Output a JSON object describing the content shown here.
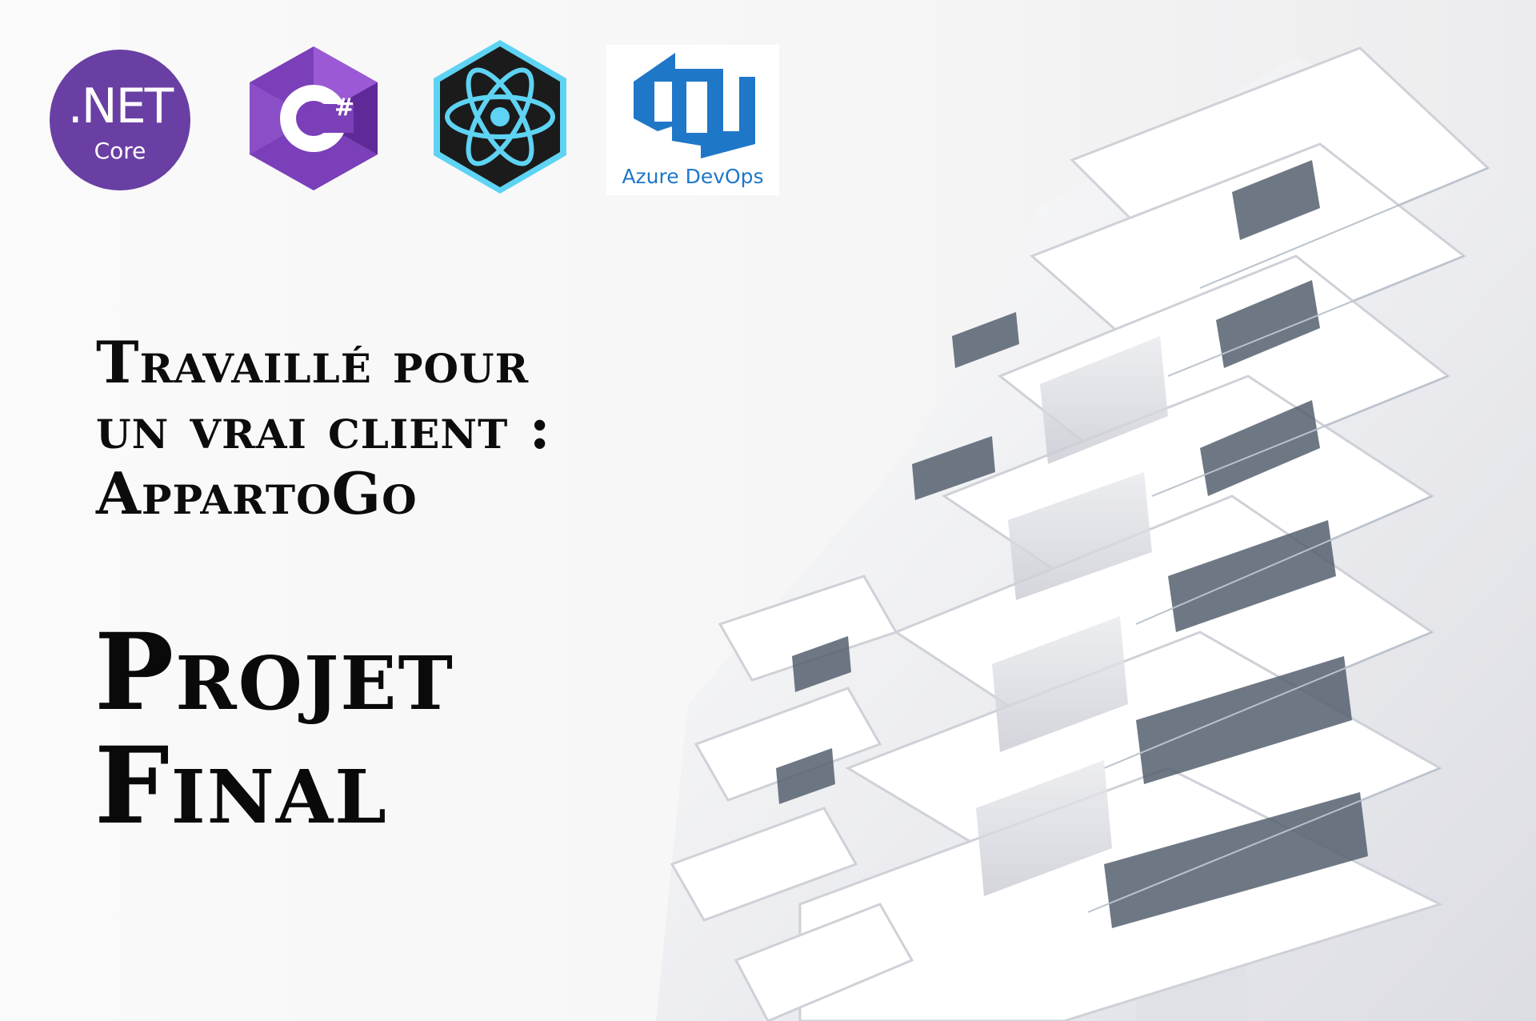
{
  "logos": {
    "dotnet": {
      "line1": ".NET",
      "line2": "Core",
      "color": "#6a3fa4"
    },
    "csharp": {
      "glyph": "C#",
      "color": "#8a4fc7"
    },
    "react": {
      "icon": "react-atom-icon",
      "color": "#5ed3f3"
    },
    "azure": {
      "label": "Azure DevOps",
      "color": "#1f77c8"
    }
  },
  "headline": {
    "subtitle_lines": [
      "Travaillé pour",
      "un vrai client :",
      "AppartoGo"
    ],
    "title_lines": [
      "Projet",
      "Final"
    ]
  },
  "background": {
    "subject": "white-building-photo"
  }
}
